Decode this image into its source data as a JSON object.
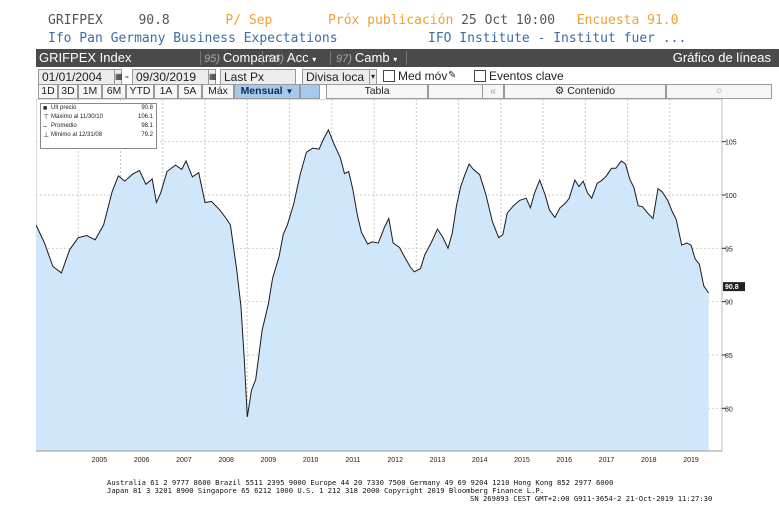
{
  "header": {
    "ticker": "GRIFPEX",
    "last_value": "90.8",
    "period": "P/ Sep",
    "next_release_label": "Próx publicación",
    "next_release_date": "25 Oct 10:00",
    "survey_label": "Encuesta",
    "survey_value": "91.0",
    "description": "Ifo Pan Germany Business Expectations",
    "source": "IFO Institute - Institut fuer ..."
  },
  "toolbar": {
    "security": "GRIFPEX Index",
    "compare_num": "95)",
    "compare_label": "Comparar",
    "actions_num": "96)",
    "actions_label": "Acc",
    "edit_num": "97)",
    "edit_label": "Camb",
    "title": "Gráfico de líneas"
  },
  "controls": {
    "start_date": "01/01/2004",
    "end_date": "09/30/2019",
    "price_field": "Last Px",
    "currency": "Divisa loca",
    "moving_avg": "Med móv",
    "key_events": "Eventos clave"
  },
  "periods": [
    {
      "label": "1D"
    },
    {
      "label": "3D"
    },
    {
      "label": "1M"
    },
    {
      "label": "6M"
    },
    {
      "label": "YTD"
    },
    {
      "label": "1A"
    },
    {
      "label": "5A"
    },
    {
      "label": "Máx"
    }
  ],
  "frequency": "Mensual",
  "table_label": "Tabla",
  "content_label": "Contenido",
  "legend": {
    "last_label": "Últ precio",
    "last_value": "90.8",
    "max_label": "Máximo al 11/30/10",
    "max_value": "106.1",
    "avg_label": "Promedio",
    "avg_value": "98.1",
    "min_label": "Mínimo al 12/31/08",
    "min_value": "79.2"
  },
  "footer": {
    "line1": "Australia 61 2 9777 8600 Brazil 5511 2395 9000 Europe 44 20 7330 7500 Germany 49 69 9204 1210 Hong Kong 852 2977 6000",
    "line2": "Japan 81 3 3201 8900        Singapore 65 6212 1000       U.S. 1 212 318 2000                 Copyright 2019 Bloomberg Finance L.P.",
    "line3": "SN 269893 CEST GMT+2:00 G911-3654-2 21-Oct-2019 11:27:30"
  },
  "colors": {
    "fill": "#cfe6fb",
    "line": "#1a1a1a",
    "toolbar": "#4a4a4a",
    "accent": "#f0a030"
  },
  "chart_data": {
    "type": "area",
    "x_ticks": [
      "2005",
      "2006",
      "2007",
      "2008",
      "2009",
      "2010",
      "2011",
      "2012",
      "2013",
      "2014",
      "2015",
      "2016",
      "2017",
      "2018",
      "2019"
    ],
    "y_ticks": [
      80,
      85,
      90,
      95,
      100,
      105
    ],
    "ylim": [
      76,
      109
    ],
    "last_label": "90.8",
    "series": [
      {
        "values": [
          [
            2004.0,
            97.2
          ],
          [
            2004.2,
            95.5
          ],
          [
            2004.4,
            93.3
          ],
          [
            2004.6,
            92.7
          ],
          [
            2004.8,
            94.9
          ],
          [
            2005.0,
            96.0
          ],
          [
            2005.2,
            96.2
          ],
          [
            2005.4,
            95.8
          ],
          [
            2005.6,
            97.2
          ],
          [
            2005.8,
            100.3
          ],
          [
            2005.95,
            101.8
          ],
          [
            2006.1,
            101.3
          ],
          [
            2006.3,
            102.0
          ],
          [
            2006.45,
            102.3
          ],
          [
            2006.6,
            101.0
          ],
          [
            2006.75,
            101.5
          ],
          [
            2006.85,
            99.3
          ],
          [
            2006.95,
            100.2
          ],
          [
            2007.1,
            102.2
          ],
          [
            2007.3,
            102.8
          ],
          [
            2007.45,
            102.4
          ],
          [
            2007.55,
            103.2
          ],
          [
            2007.7,
            101.7
          ],
          [
            2007.85,
            102.1
          ],
          [
            2008.0,
            99.3
          ],
          [
            2008.15,
            99.4
          ],
          [
            2008.35,
            98.6
          ],
          [
            2008.5,
            97.8
          ],
          [
            2008.6,
            97.2
          ],
          [
            2008.75,
            93.0
          ],
          [
            2008.85,
            89.6
          ],
          [
            2008.93,
            84.6
          ],
          [
            2009.0,
            79.2
          ],
          [
            2009.1,
            81.7
          ],
          [
            2009.2,
            82.7
          ],
          [
            2009.35,
            87.3
          ],
          [
            2009.5,
            89.8
          ],
          [
            2009.6,
            92.2
          ],
          [
            2009.75,
            94.2
          ],
          [
            2009.85,
            96.3
          ],
          [
            2009.95,
            97.2
          ],
          [
            2010.1,
            99.2
          ],
          [
            2010.25,
            101.9
          ],
          [
            2010.4,
            104.0
          ],
          [
            2010.55,
            104.4
          ],
          [
            2010.7,
            104.3
          ],
          [
            2010.8,
            105.2
          ],
          [
            2010.92,
            106.1
          ],
          [
            2011.05,
            104.8
          ],
          [
            2011.2,
            103.5
          ],
          [
            2011.3,
            102.0
          ],
          [
            2011.4,
            102.2
          ],
          [
            2011.5,
            100.5
          ],
          [
            2011.6,
            98.2
          ],
          [
            2011.7,
            96.5
          ],
          [
            2011.85,
            95.4
          ],
          [
            2011.95,
            95.6
          ],
          [
            2012.1,
            95.5
          ],
          [
            2012.25,
            97.0
          ],
          [
            2012.35,
            97.8
          ],
          [
            2012.45,
            95.5
          ],
          [
            2012.6,
            95.1
          ],
          [
            2012.72,
            94.2
          ],
          [
            2012.85,
            93.3
          ],
          [
            2012.95,
            92.8
          ],
          [
            2013.1,
            93.1
          ],
          [
            2013.2,
            94.4
          ],
          [
            2013.35,
            95.5
          ],
          [
            2013.5,
            96.8
          ],
          [
            2013.62,
            96.1
          ],
          [
            2013.75,
            95.0
          ],
          [
            2013.85,
            96.4
          ],
          [
            2013.95,
            99.0
          ],
          [
            2014.05,
            100.8
          ],
          [
            2014.15,
            101.9
          ],
          [
            2014.25,
            102.9
          ],
          [
            2014.35,
            102.4
          ],
          [
            2014.5,
            101.9
          ],
          [
            2014.65,
            100.0
          ],
          [
            2014.8,
            97.5
          ],
          [
            2014.95,
            96.0
          ],
          [
            2015.05,
            96.3
          ],
          [
            2015.15,
            98.3
          ],
          [
            2015.3,
            99.0
          ],
          [
            2015.45,
            99.5
          ],
          [
            2015.6,
            99.7
          ],
          [
            2015.7,
            98.8
          ],
          [
            2015.8,
            100.2
          ],
          [
            2015.92,
            101.4
          ],
          [
            2016.05,
            100.0
          ],
          [
            2016.15,
            98.6
          ],
          [
            2016.28,
            97.9
          ],
          [
            2016.4,
            98.8
          ],
          [
            2016.52,
            99.2
          ],
          [
            2016.62,
            99.7
          ],
          [
            2016.75,
            101.4
          ],
          [
            2016.85,
            100.8
          ],
          [
            2016.95,
            101.3
          ],
          [
            2017.05,
            100.2
          ],
          [
            2017.15,
            99.7
          ],
          [
            2017.28,
            101.1
          ],
          [
            2017.4,
            101.4
          ],
          [
            2017.5,
            101.8
          ],
          [
            2017.62,
            102.5
          ],
          [
            2017.72,
            102.5
          ],
          [
            2017.85,
            103.2
          ],
          [
            2017.95,
            102.9
          ],
          [
            2018.05,
            101.5
          ],
          [
            2018.15,
            100.7
          ],
          [
            2018.25,
            99.0
          ],
          [
            2018.35,
            98.9
          ],
          [
            2018.5,
            98.2
          ],
          [
            2018.6,
            97.8
          ],
          [
            2018.72,
            100.6
          ],
          [
            2018.82,
            100.3
          ],
          [
            2018.95,
            99.5
          ],
          [
            2019.05,
            98.5
          ],
          [
            2019.15,
            97.7
          ],
          [
            2019.28,
            95.3
          ],
          [
            2019.4,
            95.5
          ],
          [
            2019.5,
            95.3
          ],
          [
            2019.6,
            94.0
          ],
          [
            2019.7,
            93.5
          ],
          [
            2019.8,
            91.5
          ],
          [
            2019.92,
            90.8
          ]
        ]
      }
    ]
  }
}
